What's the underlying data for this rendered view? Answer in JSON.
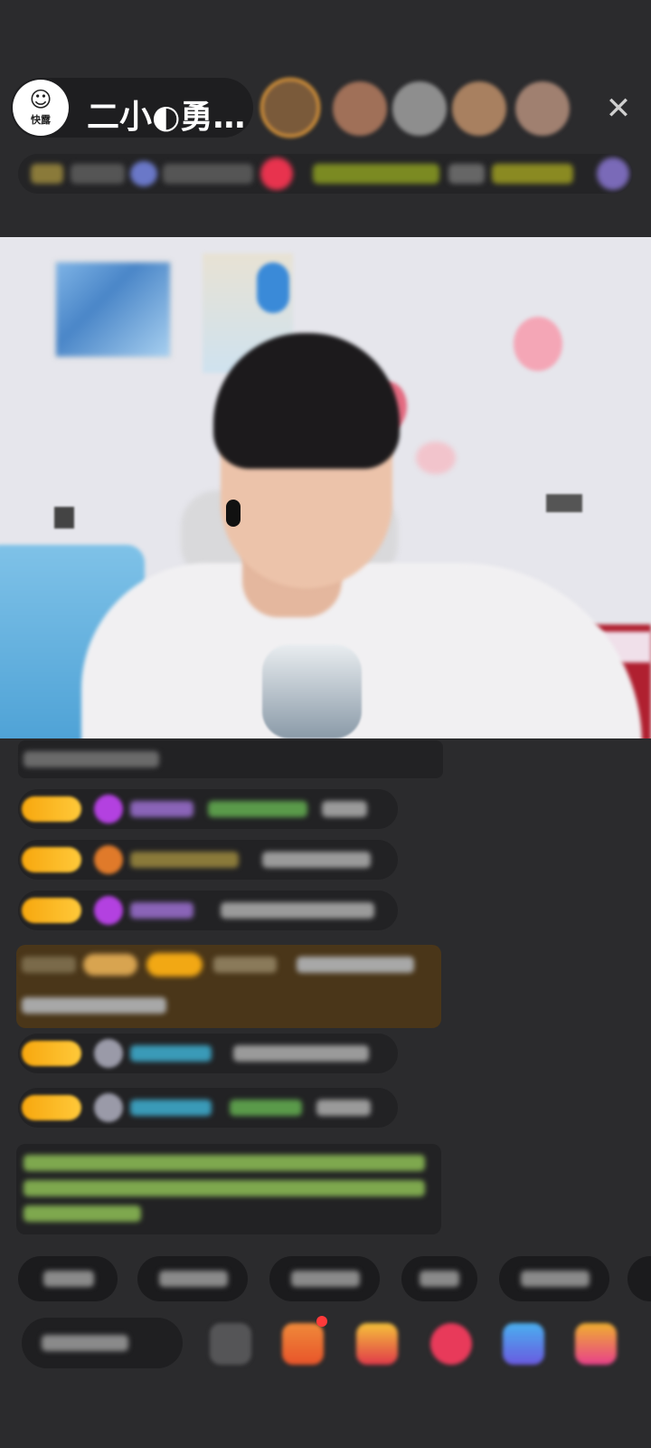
{
  "header": {
    "host_name": "二小◐勇…",
    "app_logo_text": "快露",
    "close_icon": "close-icon",
    "viewer_avatars": [
      "#c88a3c",
      "#a07058",
      "#8a8a8a",
      "#b08060",
      "#a88070"
    ],
    "accent_color": "#f7a70e"
  },
  "stream": {
    "description_icons": [
      "painting",
      "poster",
      "balloon",
      "microphone",
      "earphones"
    ]
  },
  "chat": {
    "message_count": 7,
    "badge_color": "#f7a70e",
    "gift_message_bg": "#4a3619",
    "system_message_color": "#9fd06a"
  },
  "quick_replies": {
    "count": 5
  },
  "bottom_bar": {
    "tools": [
      "emoji-icon",
      "gift-box-icon",
      "red-packet-icon",
      "heart-icon",
      "game-controller-icon",
      "gift-icon"
    ]
  }
}
